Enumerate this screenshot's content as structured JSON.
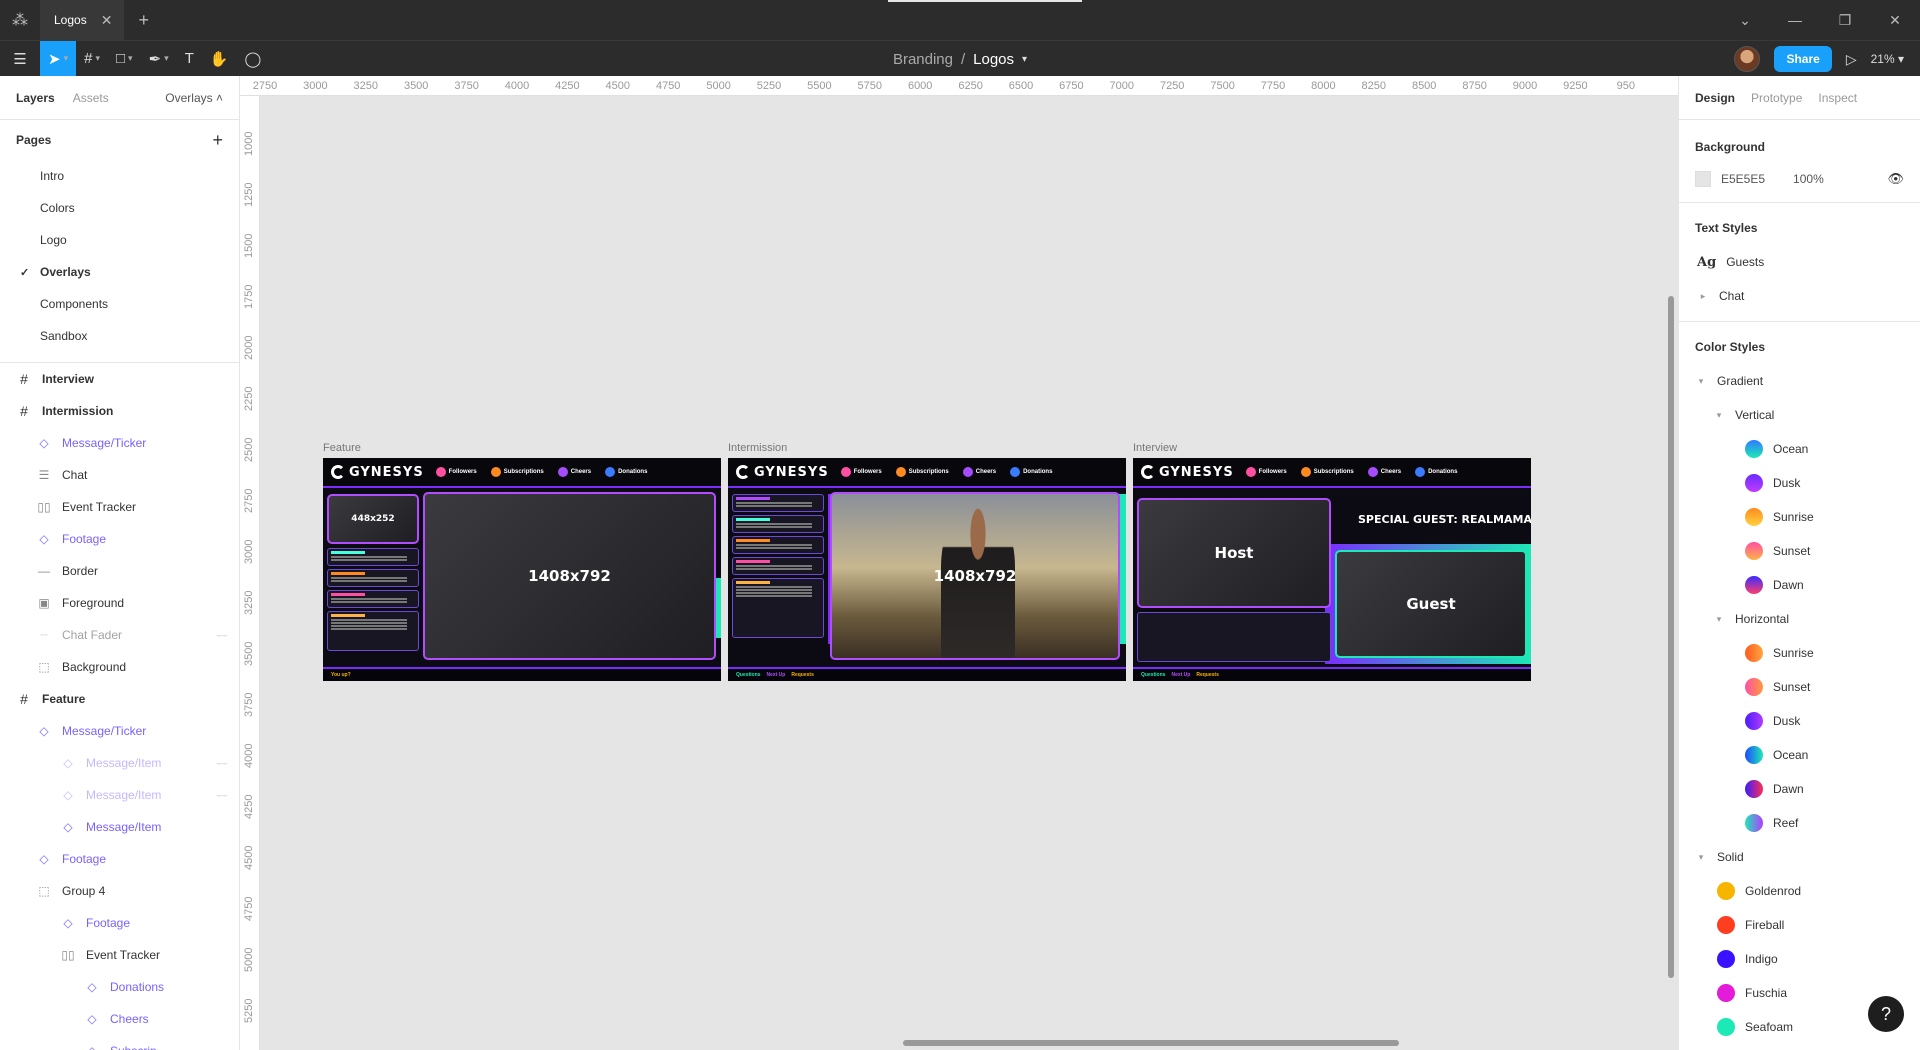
{
  "titlebar": {
    "tab_title": "Logos",
    "tab_close": "✕",
    "tab_add": "+",
    "controls": [
      "⌄",
      "—",
      "❐",
      "✕"
    ]
  },
  "toolbar": {
    "breadcrumb_parent": "Branding",
    "breadcrumb_sep": "/",
    "breadcrumb_current": "Logos",
    "share_label": "Share",
    "zoom_label": "21%"
  },
  "left_panel": {
    "tabs": {
      "layers": "Layers",
      "assets": "Assets",
      "page_selector": "Overlays"
    },
    "pages_title": "Pages",
    "pages": [
      "Intro",
      "Colors",
      "Logo",
      "Overlays",
      "Components",
      "Sandbox"
    ],
    "current_page": "Overlays",
    "layers": [
      {
        "label": "Interview",
        "kind": "frame",
        "icon": "frame-icon"
      },
      {
        "label": "Intermission",
        "kind": "frame",
        "icon": "frame-icon"
      },
      {
        "label": "Message/Ticker",
        "kind": "component",
        "icon": "instance-icon"
      },
      {
        "label": "Chat",
        "kind": "plain",
        "icon": "auto-layout-icon"
      },
      {
        "label": "Event Tracker",
        "kind": "plain",
        "icon": "columns-icon"
      },
      {
        "label": "Footage",
        "kind": "component",
        "icon": "instance-icon"
      },
      {
        "label": "Border",
        "kind": "plain",
        "icon": "line-icon"
      },
      {
        "label": "Foreground",
        "kind": "plain",
        "icon": "image-icon"
      },
      {
        "label": "Chat Fader",
        "kind": "faded",
        "icon": "dashes-icon"
      },
      {
        "label": "Background",
        "kind": "plain",
        "icon": "group-icon"
      },
      {
        "label": "Feature",
        "kind": "frame",
        "icon": "frame-icon"
      },
      {
        "label": "Message/Ticker",
        "kind": "component",
        "icon": "instance-icon"
      },
      {
        "label": "Message/Item",
        "kind": "component-faded",
        "icon": "instance-icon"
      },
      {
        "label": "Message/Item",
        "kind": "component-faded",
        "icon": "instance-icon"
      },
      {
        "label": "Message/Item",
        "kind": "component",
        "icon": "instance-icon"
      },
      {
        "label": "Footage",
        "kind": "component",
        "icon": "instance-icon"
      },
      {
        "label": "Group 4",
        "kind": "plain",
        "icon": "group-icon"
      },
      {
        "label": "Footage",
        "kind": "component",
        "icon": "instance-icon"
      },
      {
        "label": "Event Tracker",
        "kind": "plain",
        "icon": "columns-icon"
      },
      {
        "label": "Donations",
        "kind": "component",
        "icon": "instance-icon"
      },
      {
        "label": "Cheers",
        "kind": "component",
        "icon": "instance-icon"
      },
      {
        "label": "Subscrip...",
        "kind": "component",
        "icon": "instance-icon"
      }
    ]
  },
  "canvas": {
    "ruler_x": [
      "2750",
      "3000",
      "3250",
      "3500",
      "3750",
      "4000",
      "4250",
      "4500",
      "4750",
      "5000",
      "5250",
      "5500",
      "5750",
      "6000",
      "6250",
      "6500",
      "6750",
      "7000",
      "7250",
      "7500",
      "7750",
      "8000",
      "8250",
      "8500",
      "8750",
      "9000",
      "9250",
      "950"
    ],
    "ruler_y": [
      "1000",
      "1250",
      "1500",
      "1750",
      "2000",
      "2250",
      "2500",
      "2750",
      "3000",
      "3250",
      "3500",
      "3750",
      "4000",
      "4250",
      "4500",
      "4750",
      "5000",
      "5250"
    ],
    "frames": [
      {
        "label": "Feature",
        "main_dim": "1408x792",
        "cam_dim": "448x252"
      },
      {
        "label": "Intermission",
        "main_dim": "1408x792"
      },
      {
        "label": "Interview",
        "headline": "SPECIAL GUEST: REALMAMAEAGLE",
        "host": "Host",
        "guest": "Guest"
      }
    ],
    "overlay": {
      "brand": "GYNESYS",
      "stats": [
        {
          "label": "Followers",
          "color": "#ff4fa3"
        },
        {
          "label": "Subscriptions",
          "color": "#ff8a1f"
        },
        {
          "label": "Cheers",
          "color": "#a74bff"
        },
        {
          "label": "Donations",
          "color": "#3a7bff"
        }
      ],
      "ticker_keywords": [
        "You up?",
        "Questions",
        "Next Up",
        "Requests"
      ]
    }
  },
  "right_panel": {
    "tabs": {
      "design": "Design",
      "prototype": "Prototype",
      "inspect": "Inspect"
    },
    "background_title": "Background",
    "bg_hex": "E5E5E5",
    "bg_opacity": "100%",
    "text_styles_title": "Text Styles",
    "text_styles": [
      "Guests",
      "Chat"
    ],
    "color_styles_title": "Color Styles",
    "gradient_group": "Gradient",
    "vertical_group": "Vertical",
    "vertical": [
      {
        "name": "Ocean",
        "c1": "#2f7bff",
        "c2": "#1de9b6"
      },
      {
        "name": "Dusk",
        "c1": "#6a2cff",
        "c2": "#c23bff"
      },
      {
        "name": "Sunrise",
        "c1": "#ff8a1f",
        "c2": "#ffd23f"
      },
      {
        "name": "Sunset",
        "c1": "#ff4fa3",
        "c2": "#ffb347"
      },
      {
        "name": "Dawn",
        "c1": "#3a2cff",
        "c2": "#ff3d6e"
      }
    ],
    "horizontal_group": "Horizontal",
    "horizontal": [
      {
        "name": "Sunrise",
        "c1": "#ff5a1f",
        "c2": "#ffa63f"
      },
      {
        "name": "Sunset",
        "c1": "#ff4fa3",
        "c2": "#ff9a3f"
      },
      {
        "name": "Dusk",
        "c1": "#4b1dff",
        "c2": "#b23bff"
      },
      {
        "name": "Ocean",
        "c1": "#1d4bff",
        "c2": "#1de9b6"
      },
      {
        "name": "Dawn",
        "c1": "#3a1dff",
        "c2": "#ff2d55"
      },
      {
        "name": "Reef",
        "c1": "#1de9b6",
        "c2": "#b23bff"
      }
    ],
    "solid_group": "Solid",
    "solid": [
      {
        "name": "Goldenrod",
        "color": "#f7b500"
      },
      {
        "name": "Fireball",
        "color": "#ff3d1f"
      },
      {
        "name": "Indigo",
        "color": "#3a12ff"
      },
      {
        "name": "Fuschia",
        "color": "#e41bd8"
      },
      {
        "name": "Seafoam",
        "color": "#1de9b6"
      }
    ],
    "help": "?"
  }
}
